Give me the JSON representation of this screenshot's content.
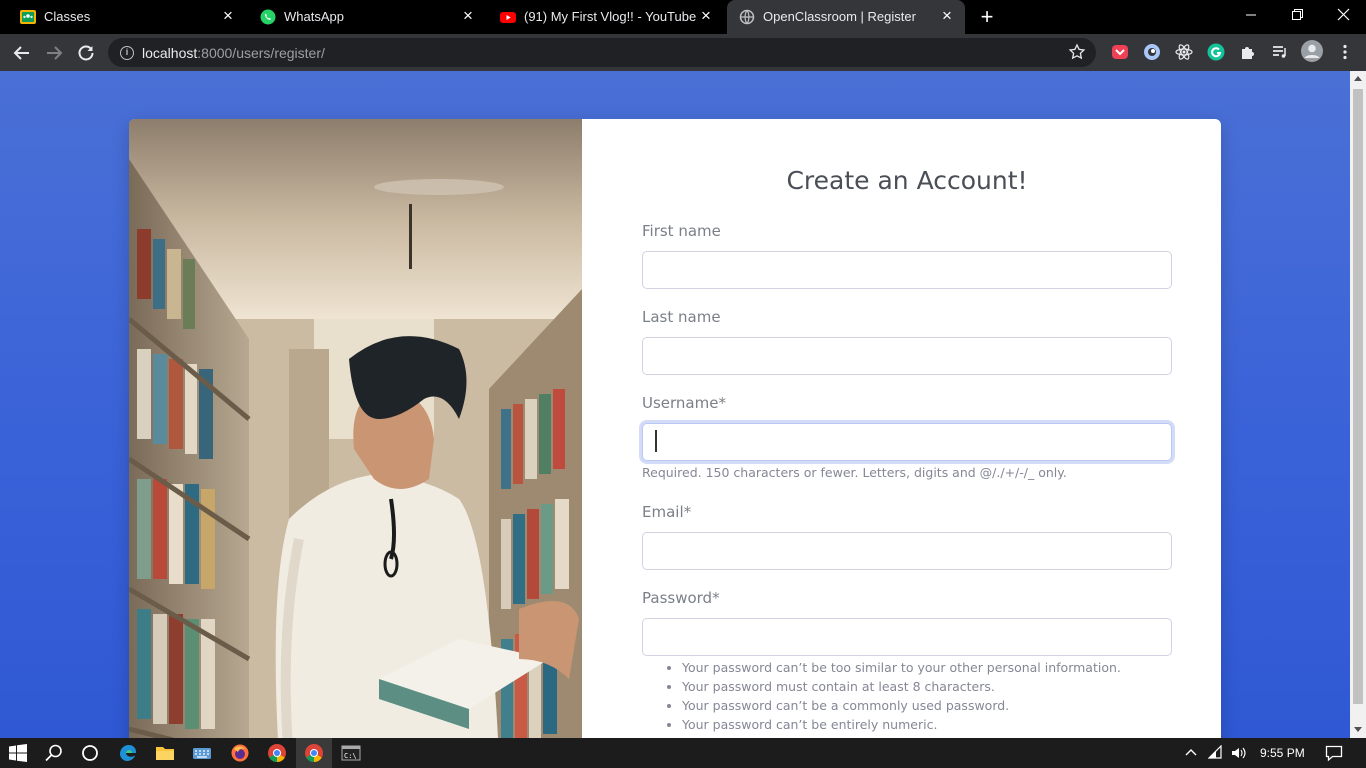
{
  "browser": {
    "tabs": [
      {
        "title": "Classes",
        "icon": "google-classroom-icon",
        "active": false
      },
      {
        "title": "WhatsApp",
        "icon": "whatsapp-icon",
        "active": false
      },
      {
        "title": "(91) My First Vlog!! - YouTube",
        "icon": "youtube-icon",
        "active": false
      },
      {
        "title": "OpenClassroom | Register",
        "icon": "globe-icon",
        "active": true
      }
    ],
    "address": {
      "host": "localhost",
      "rest": ":8000/users/register/"
    }
  },
  "page": {
    "heading": "Create an Account!",
    "fields": {
      "first_name": {
        "label": "First name",
        "value": ""
      },
      "last_name": {
        "label": "Last name",
        "value": ""
      },
      "username": {
        "label": "Username*",
        "value": "",
        "help": "Required. 150 characters or fewer. Letters, digits and @/./+/-/_ only."
      },
      "email": {
        "label": "Email*",
        "value": ""
      },
      "password": {
        "label": "Password*",
        "value": ""
      }
    },
    "password_rules": [
      "Your password can’t be too similar to your other personal information.",
      "Your password must contain at least 8 characters.",
      "Your password can’t be a commonly used password.",
      "Your password can’t be entirely numeric."
    ]
  },
  "taskbar": {
    "clock": "9:55 PM"
  },
  "colors": {
    "page_bg": "#3a62d8",
    "tab_strip": "#000000",
    "toolbar": "#35363a",
    "focus_ring": "#bac8f3"
  }
}
